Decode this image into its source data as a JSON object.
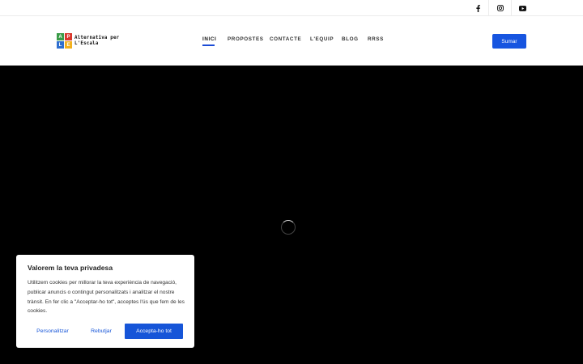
{
  "social": {
    "facebook_icon": "facebook-icon",
    "instagram_icon": "instagram-icon",
    "youtube_icon": "youtube-icon"
  },
  "logo": {
    "letters": [
      "A",
      "P",
      "L",
      "E"
    ],
    "colors": [
      "#3a9b47",
      "#d9362b",
      "#2f6fcf",
      "#f2b11d"
    ],
    "line1": "Alternativa per",
    "line2": "L'Escala"
  },
  "nav": {
    "items": [
      "INICI",
      "PROPOSTES",
      "CONTACTE",
      "L'EQUIP",
      "BLOG",
      "RRSS"
    ],
    "active": "INICI"
  },
  "header": {
    "cta_label": "Sumar"
  },
  "cookie": {
    "title": "Valorem la teva privadesa",
    "body": "Utilitzem cookies per millorar la teva experiència de navegació, publicar anuncis o contingut personalitzats i analitzar el nostre trànsit. En fer clic a \"Acceptar-ho tot\", acceptes l'ús que fem de les cookies.",
    "customize_label": "Personalitzar",
    "reject_label": "Rebutjar",
    "accept_label": "Accepta-ho tot"
  },
  "colors": {
    "accent": "#1655d8",
    "hero_bg": "#000000"
  }
}
